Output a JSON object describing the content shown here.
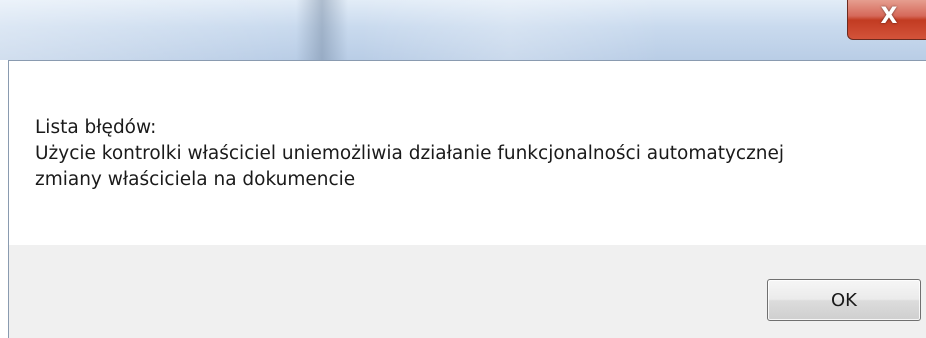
{
  "titlebar": {
    "close_label": "X"
  },
  "message": {
    "header": "Lista błędów:",
    "line1": "Użycie kontrolki właściciel uniemożliwia działanie funkcjonalności automatycznej",
    "line2": "zmiany właściciela na dokumencie"
  },
  "buttons": {
    "ok_label": "OK"
  },
  "colors": {
    "close_button": "#c23b22",
    "button_bar": "#f0f0f0",
    "content_bg": "#ffffff"
  }
}
